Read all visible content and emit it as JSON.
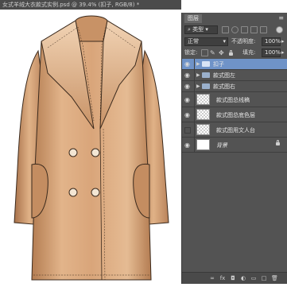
{
  "window": {
    "title": "女式羊绒大衣款式实例.psd @ 39.4% (扣子, RGB/8) *"
  },
  "layers_panel": {
    "tab_label": "图层",
    "menu_icon": "menu-icon",
    "filter_kind": "类型",
    "blend_mode": "正常",
    "opacity_label": "不透明度:",
    "opacity_value": "100%",
    "lock_label": "锁定:",
    "fill_label": "填充:",
    "fill_value": "100%",
    "layers": [
      {
        "name": "扣子",
        "type": "group",
        "selected": true,
        "visible": true
      },
      {
        "name": "款式图左",
        "type": "group",
        "selected": false,
        "visible": true
      },
      {
        "name": "款式图右",
        "type": "group",
        "selected": false,
        "visible": true
      },
      {
        "name": "款式图总线稿",
        "type": "layer",
        "selected": false,
        "visible": true
      },
      {
        "name": "款式图总底色层",
        "type": "layer",
        "selected": false,
        "visible": true
      },
      {
        "name": "款式图用文人台",
        "type": "layer",
        "selected": false,
        "visible": false
      },
      {
        "name": "背景",
        "type": "background",
        "selected": false,
        "visible": true,
        "locked": true
      }
    ]
  },
  "colors": {
    "coat_main": "#d9a57a",
    "coat_shadow": "#b47d52",
    "coat_highlight": "#f1d3b4",
    "panel_bg": "#535353",
    "selected_layer": "#6f93c8"
  }
}
